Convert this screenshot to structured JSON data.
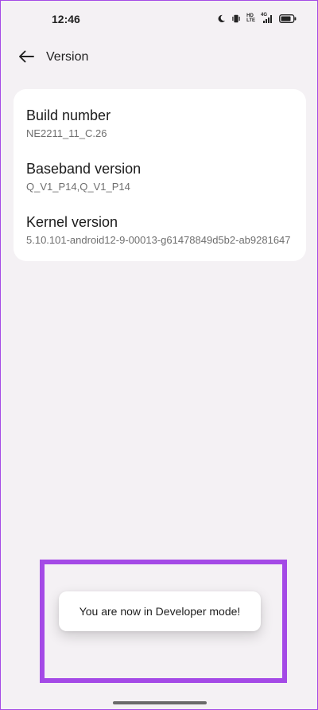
{
  "status_bar": {
    "time": "12:46",
    "icons": [
      "moon-icon",
      "vibrate-icon",
      "hd-lte-icon",
      "signal-icon",
      "battery-icon"
    ],
    "lte_top": "HD",
    "lte_bottom": "LTE",
    "signal_badge": "4G"
  },
  "app_bar": {
    "back_icon": "arrow-left-icon",
    "title": "Version"
  },
  "version_info": {
    "items": [
      {
        "title": "Build number",
        "value": "NE2211_11_C.26"
      },
      {
        "title": "Baseband version",
        "value": "Q_V1_P14,Q_V1_P14"
      },
      {
        "title": "Kernel version",
        "value": "5.10.101-android12-9-00013-g61478849d5b2-ab9281647"
      }
    ]
  },
  "toast": {
    "message": "You are now in Developer mode!"
  },
  "colors": {
    "background": "#f4f1f4",
    "card": "#ffffff",
    "highlight": "#a44ae6"
  }
}
